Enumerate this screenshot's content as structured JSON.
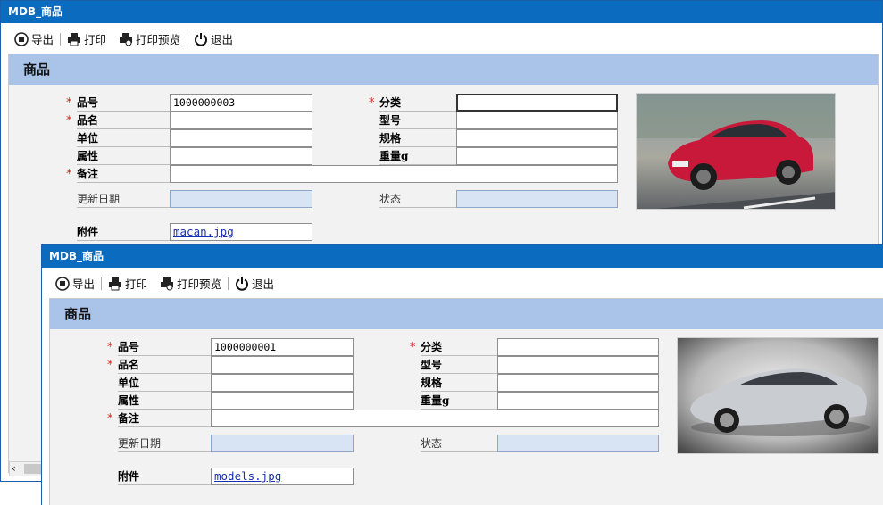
{
  "back_window": {
    "title": "MDB_商品",
    "toolbar": {
      "export": "导出",
      "print": "打印",
      "print_preview": "打印预览",
      "exit": "退出"
    },
    "section_title": "商品",
    "labels": {
      "item_no": "品号",
      "category": "分类",
      "item_name": "品名",
      "model": "型号",
      "unit": "单位",
      "spec": "规格",
      "attribute": "属性",
      "weight": "重量g",
      "remark": "备注",
      "updated": "更新日期",
      "status": "状态",
      "attachment": "附件"
    },
    "values": {
      "item_no": "1000000003",
      "category": "",
      "item_name": "",
      "model": "",
      "unit": "",
      "spec": "",
      "attribute": "",
      "weight": "",
      "remark": "",
      "updated": "",
      "status": "",
      "attachment": "macan.jpg"
    },
    "photo_color": "#c8193a"
  },
  "front_window": {
    "title": "MDB_商品",
    "toolbar": {
      "export": "导出",
      "print": "打印",
      "print_preview": "打印预览",
      "exit": "退出"
    },
    "section_title": "商品",
    "labels": {
      "item_no": "品号",
      "category": "分类",
      "item_name": "品名",
      "model": "型号",
      "unit": "单位",
      "spec": "规格",
      "attribute": "属性",
      "weight": "重量g",
      "remark": "备注",
      "updated": "更新日期",
      "status": "状态",
      "attachment": "附件"
    },
    "values": {
      "item_no": "1000000001",
      "category": "",
      "item_name": "",
      "model": "",
      "unit": "",
      "spec": "",
      "attribute": "",
      "weight": "",
      "remark": "",
      "updated": "",
      "status": "",
      "attachment": "models.jpg"
    },
    "photo_color": "#c9cdd2"
  },
  "required_marker": "*",
  "scroll_arrow": "‹",
  "colors": {
    "title_bar": "#0b6bbf",
    "section_header": "#a9c4e8",
    "required": "#d22222",
    "readonly_field": "#d8e4f3",
    "link": "#1a2fb0"
  }
}
